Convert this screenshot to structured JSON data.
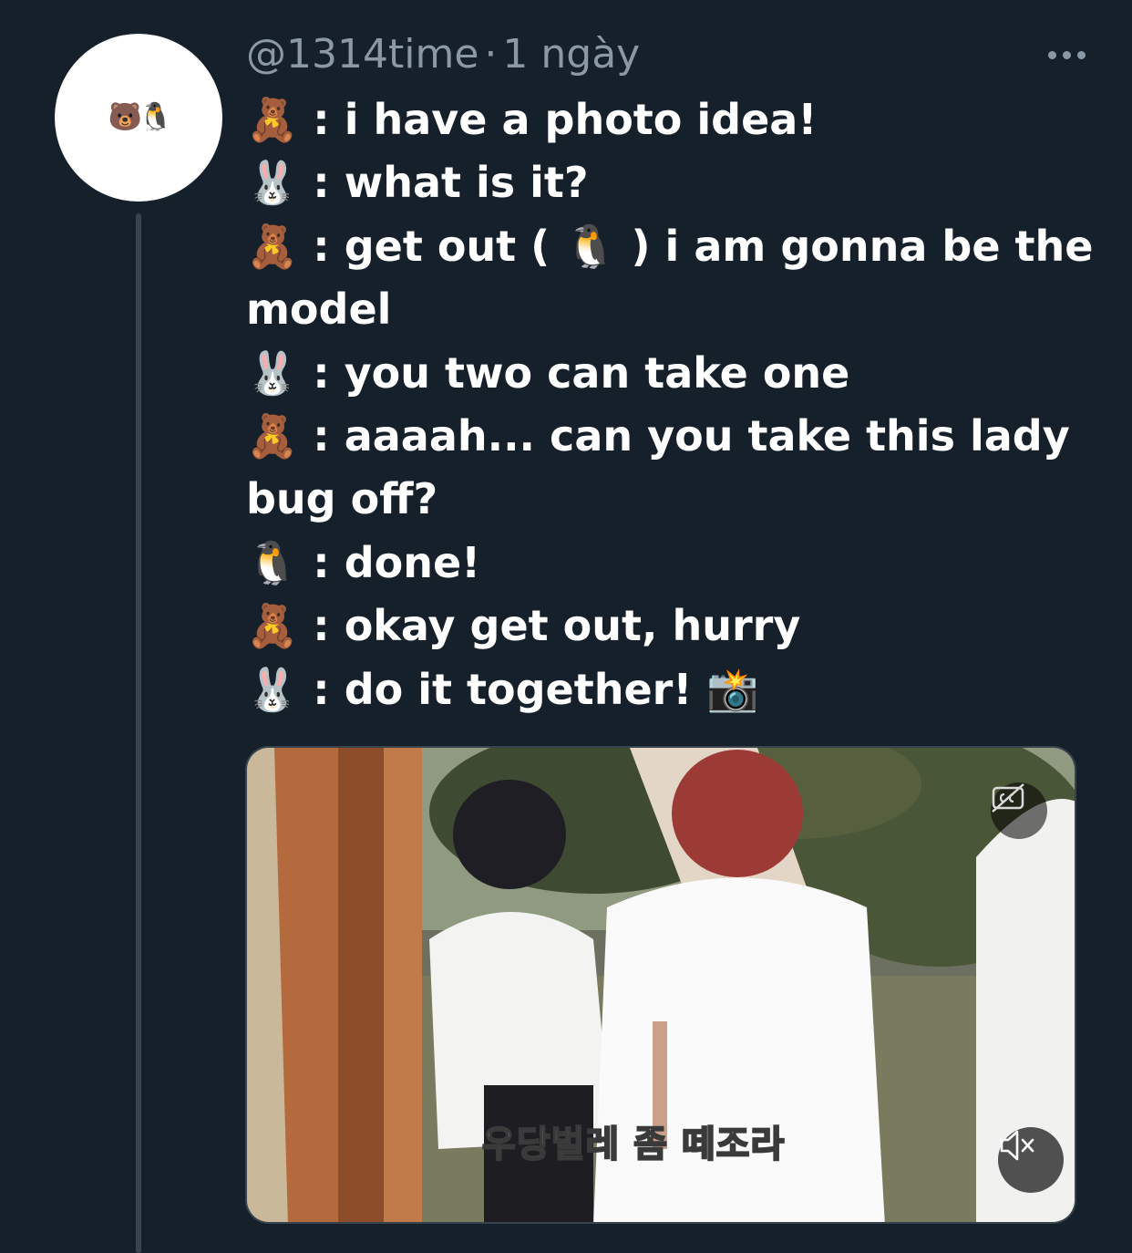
{
  "tweet": {
    "handle": "@1314time",
    "separator": "·",
    "time": "1 ngày",
    "avatar_emoji": "🐻🐧",
    "lines": [
      "🧸 : i have a photo idea!",
      "🐰 : what is it?",
      "🧸 : get out ( 🐧 ) i am gonna be the",
      "model",
      "🐰 : you two can take one",
      "🧸 : aaaah... can you take this lady",
      "bug off?",
      "🐧 : done!",
      "🧸 : okay get out, hurry",
      "🐰 : do it together! 📸"
    ]
  },
  "media": {
    "subtitle": "우당벌레 좀 떼조라",
    "caption_icon": "closed-captions-off-icon",
    "mute_icon": "volume-muted-icon"
  },
  "colors": {
    "background": "#15202b",
    "muted_text": "#8b98a5",
    "thread_line": "#38444d"
  }
}
